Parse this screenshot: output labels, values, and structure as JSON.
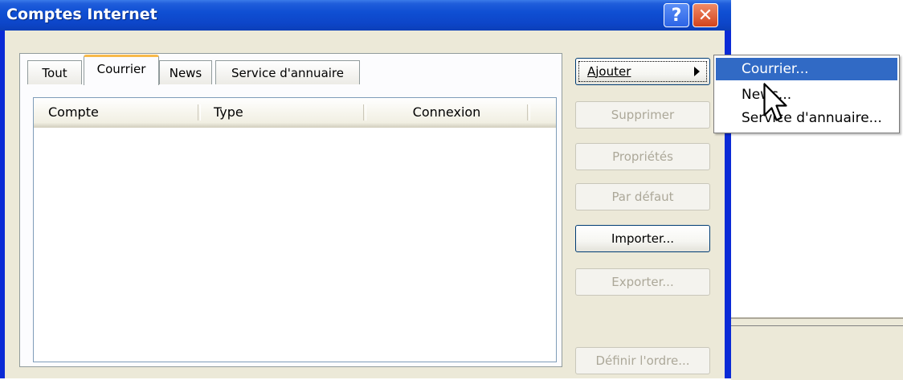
{
  "window": {
    "title": "Comptes Internet",
    "help_glyph": "?",
    "close_glyph": "✕"
  },
  "tabs": [
    {
      "label": "Tout",
      "active": false
    },
    {
      "label": "Courrier",
      "active": true
    },
    {
      "label": "News",
      "active": false
    },
    {
      "label": "Service d'annuaire",
      "active": false
    }
  ],
  "list": {
    "columns": [
      "Compte",
      "Type",
      "Connexion"
    ],
    "rows": []
  },
  "buttons": {
    "ajouter": "Ajouter",
    "supprimer": "Supprimer",
    "proprietes": "Propriétés",
    "par_defaut": "Par défaut",
    "importer": "Importer...",
    "exporter": "Exporter...",
    "definir_ordre": "Définir l'ordre..."
  },
  "menu": {
    "items": [
      "Courrier...",
      "News...",
      "Service d'annuaire..."
    ],
    "highlighted": "Courrier..."
  },
  "icons": {
    "cursor": "arrow-cursor-icon",
    "submenu_arrow": "right-triangle-icon"
  },
  "colors": {
    "title_bar": "#0d46c9",
    "dialog_bg": "#ece9d8",
    "menu_highlight": "#316ac5",
    "active_tab_accent": "#f7b94a",
    "close_button": "#d4441c"
  }
}
